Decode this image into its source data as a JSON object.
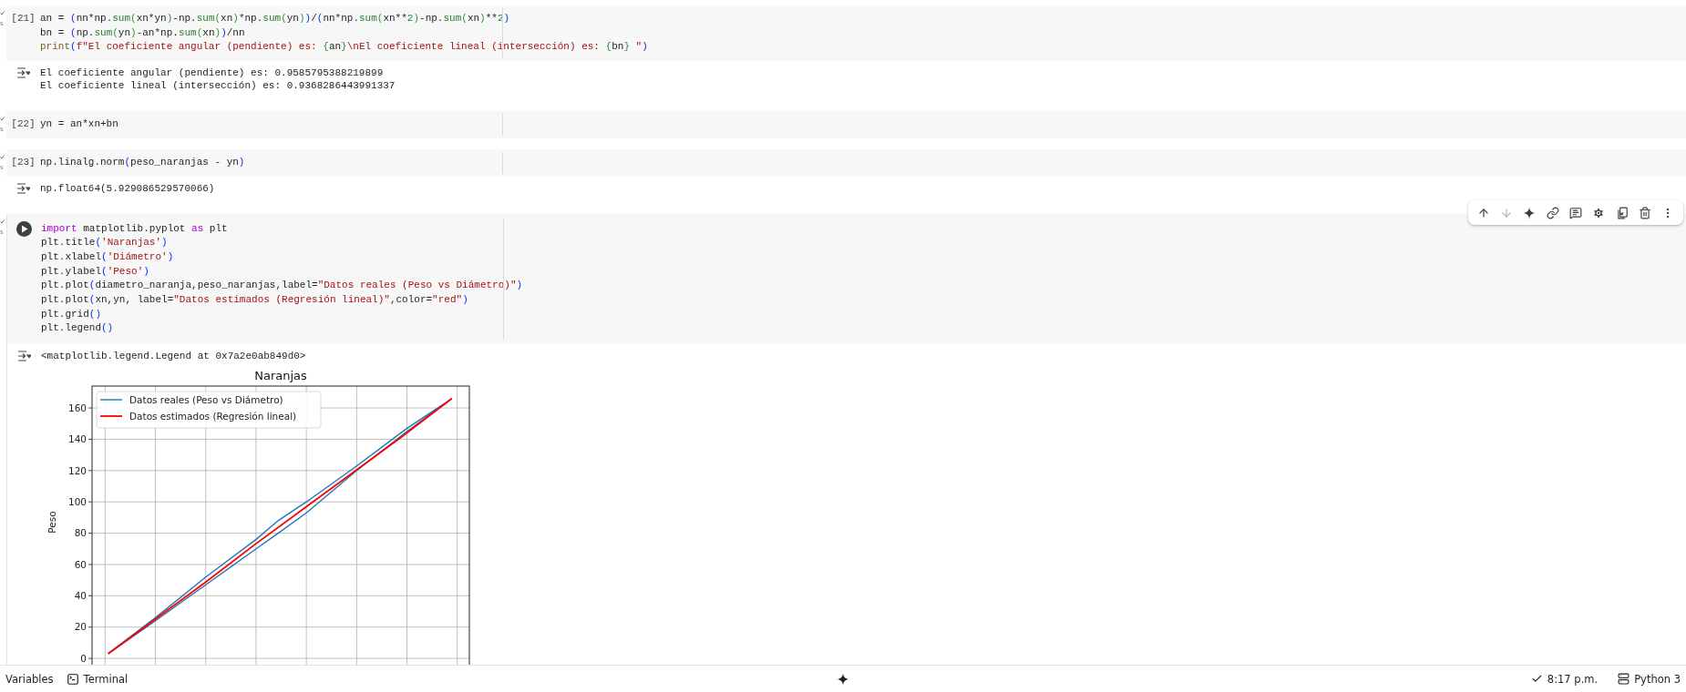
{
  "notebook": {
    "cells": [
      {
        "count": "[21]",
        "executed": true,
        "exec_time": "s",
        "focused": false,
        "code": [
          [
            {
              "kind": "plain",
              "text": "an = "
            },
            {
              "kind": "bracket1",
              "text": "("
            },
            {
              "kind": "plain",
              "text": "nn*np."
            },
            {
              "kind": "builtin",
              "text": "sum"
            },
            {
              "kind": "bracket2",
              "text": "("
            },
            {
              "kind": "plain",
              "text": "xn*yn"
            },
            {
              "kind": "bracket2",
              "text": ")"
            },
            {
              "kind": "plain",
              "text": "-np."
            },
            {
              "kind": "builtin",
              "text": "sum"
            },
            {
              "kind": "bracket2",
              "text": "("
            },
            {
              "kind": "plain",
              "text": "xn"
            },
            {
              "kind": "bracket2",
              "text": ")"
            },
            {
              "kind": "plain",
              "text": "*np."
            },
            {
              "kind": "builtin",
              "text": "sum"
            },
            {
              "kind": "bracket2",
              "text": "("
            },
            {
              "kind": "plain",
              "text": "yn"
            },
            {
              "kind": "bracket2",
              "text": ")"
            },
            {
              "kind": "bracket1",
              "text": ")"
            },
            {
              "kind": "plain",
              "text": "/"
            },
            {
              "kind": "bracket1",
              "text": "("
            },
            {
              "kind": "plain",
              "text": "nn*np."
            },
            {
              "kind": "builtin",
              "text": "sum"
            },
            {
              "kind": "bracket2",
              "text": "("
            },
            {
              "kind": "plain",
              "text": "xn**"
            },
            {
              "kind": "number",
              "text": "2"
            },
            {
              "kind": "bracket2",
              "text": ")"
            },
            {
              "kind": "plain",
              "text": "-np."
            },
            {
              "kind": "builtin",
              "text": "sum"
            },
            {
              "kind": "bracket2",
              "text": "("
            },
            {
              "kind": "plain",
              "text": "xn"
            },
            {
              "kind": "bracket2",
              "text": ")"
            },
            {
              "kind": "plain",
              "text": "**"
            },
            {
              "kind": "number",
              "text": "2"
            },
            {
              "kind": "bracket1",
              "text": ")"
            }
          ],
          [
            {
              "kind": "plain",
              "text": "bn = "
            },
            {
              "kind": "bracket1",
              "text": "("
            },
            {
              "kind": "plain",
              "text": "np."
            },
            {
              "kind": "builtin",
              "text": "sum"
            },
            {
              "kind": "bracket2",
              "text": "("
            },
            {
              "kind": "plain",
              "text": "yn"
            },
            {
              "kind": "bracket2",
              "text": ")"
            },
            {
              "kind": "plain",
              "text": "-an*np."
            },
            {
              "kind": "builtin",
              "text": "sum"
            },
            {
              "kind": "bracket2",
              "text": "("
            },
            {
              "kind": "plain",
              "text": "xn"
            },
            {
              "kind": "bracket2",
              "text": ")"
            },
            {
              "kind": "bracket1",
              "text": ")"
            },
            {
              "kind": "plain",
              "text": "/nn"
            }
          ],
          [
            {
              "kind": "call",
              "text": "print"
            },
            {
              "kind": "bracket1",
              "text": "("
            },
            {
              "kind": "string",
              "text": "f\"El coeficiente angular (pendiente) es: "
            },
            {
              "kind": "bracket2",
              "text": "{"
            },
            {
              "kind": "plain",
              "text": "an"
            },
            {
              "kind": "bracket2",
              "text": "}"
            },
            {
              "kind": "string",
              "text": "\\nEl coeficiente lineal (intersección) es: "
            },
            {
              "kind": "bracket2",
              "text": "{"
            },
            {
              "kind": "plain",
              "text": "bn"
            },
            {
              "kind": "bracket2",
              "text": "}"
            },
            {
              "kind": "string",
              "text": " \""
            },
            {
              "kind": "bracket1",
              "text": ")"
            }
          ]
        ],
        "output": {
          "kind": "text",
          "lines": [
            "El coeficiente angular (pendiente) es: 0.9585795388219899",
            "El coeficiente lineal (intersección) es: 0.9368286443991337"
          ]
        }
      },
      {
        "count": "[22]",
        "executed": true,
        "exec_time": "s",
        "focused": false,
        "code": [
          [
            {
              "kind": "plain",
              "text": "yn = an*xn+bn"
            }
          ]
        ]
      },
      {
        "count": "[23]",
        "executed": true,
        "exec_time": "s",
        "focused": false,
        "code": [
          [
            {
              "kind": "plain",
              "text": "np.linalg.norm"
            },
            {
              "kind": "bracket1",
              "text": "("
            },
            {
              "kind": "plain",
              "text": "peso_naranjas - yn"
            },
            {
              "kind": "bracket1",
              "text": ")"
            }
          ]
        ],
        "output": {
          "kind": "text",
          "lines": [
            "np.float64(5.929086529570066)"
          ]
        }
      },
      {
        "executed": true,
        "exec_time": "s",
        "focused": true,
        "code": [
          [
            {
              "kind": "keyword",
              "text": "import"
            },
            {
              "kind": "plain",
              "text": " matplotlib.pyplot "
            },
            {
              "kind": "keyword",
              "text": "as"
            },
            {
              "kind": "plain",
              "text": " plt"
            }
          ],
          [
            {
              "kind": "plain",
              "text": "plt.title"
            },
            {
              "kind": "bracket1",
              "text": "("
            },
            {
              "kind": "string",
              "text": "'Naranjas'"
            },
            {
              "kind": "bracket1",
              "text": ")"
            }
          ],
          [
            {
              "kind": "plain",
              "text": "plt.xlabel"
            },
            {
              "kind": "bracket1",
              "text": "("
            },
            {
              "kind": "string",
              "text": "'Diámetro'"
            },
            {
              "kind": "bracket1",
              "text": ")"
            }
          ],
          [
            {
              "kind": "plain",
              "text": "plt.ylabel"
            },
            {
              "kind": "bracket1",
              "text": "("
            },
            {
              "kind": "string",
              "text": "'Peso'"
            },
            {
              "kind": "bracket1",
              "text": ")"
            }
          ],
          [
            {
              "kind": "plain",
              "text": "plt.plot"
            },
            {
              "kind": "bracket1",
              "text": "("
            },
            {
              "kind": "plain",
              "text": "diametro_naranja,peso_naranjas,label="
            },
            {
              "kind": "string",
              "text": "\"Datos reales (Peso vs Diámetro)\""
            },
            {
              "kind": "bracket1",
              "text": ")"
            }
          ],
          [
            {
              "kind": "plain",
              "text": "plt.plot"
            },
            {
              "kind": "bracket1",
              "text": "("
            },
            {
              "kind": "plain",
              "text": "xn,yn, label="
            },
            {
              "kind": "string",
              "text": "\"Datos estimados (Regresión lineal)\""
            },
            {
              "kind": "plain",
              "text": ",color="
            },
            {
              "kind": "string",
              "text": "\"red\""
            },
            {
              "kind": "bracket1",
              "text": ")"
            }
          ],
          [
            {
              "kind": "plain",
              "text": "plt.grid"
            },
            {
              "kind": "bracket1",
              "text": "()"
            }
          ],
          [
            {
              "kind": "plain",
              "text": "plt.legend"
            },
            {
              "kind": "bracket1",
              "text": "()"
            }
          ]
        ],
        "output": {
          "kind": "chart",
          "lines": [
            "<matplotlib.legend.Legend at 0x7a2e0ab849d0>"
          ],
          "measured_curve": {
            "name": "Datos reales (Peso vs Diámetro)",
            "color": "#1f77b4"
          },
          "chart_data": {
            "type": "line",
            "title": "Naranjas",
            "ylabel": "Peso",
            "grid": true,
            "legend": true,
            "categories": [
              null,
              null,
              null,
              null,
              null,
              null,
              null,
              null
            ],
            "ylim": [
              -10,
              174
            ],
            "yticks": [
              0,
              20,
              40,
              60,
              80,
              100,
              120,
              140,
              160
            ],
            "series": [
              {
                "name": "Datos estimados (Regresión lineal)",
                "color": "#ff0000",
                "values": [
                  3,
                  26,
                  49,
                  73,
                  96,
                  119,
                  142,
                  166
                ]
              }
            ]
          }
        }
      }
    ]
  },
  "cell_toolbar": {
    "buttons": [
      {
        "kind": "up",
        "disabled": false
      },
      {
        "kind": "down",
        "disabled": true
      },
      {
        "kind": "sparkle",
        "disabled": false
      },
      {
        "kind": "link",
        "disabled": false
      },
      {
        "kind": "comment",
        "disabled": false
      },
      {
        "kind": "settings",
        "disabled": false
      },
      {
        "kind": "mirror",
        "disabled": false
      },
      {
        "kind": "delete",
        "disabled": false
      },
      {
        "kind": "more",
        "disabled": false
      }
    ]
  },
  "status_bar": {
    "variables": "Variables",
    "terminal": "Terminal",
    "time": "8:17 p.m.",
    "runtime": "Python 3"
  }
}
